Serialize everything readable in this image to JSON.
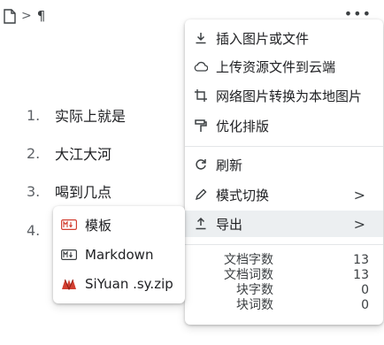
{
  "breadcrumb": {
    "doc_icon": "file-icon",
    "separator": ">",
    "block": "¶"
  },
  "toolbar": {
    "more_label": "•••"
  },
  "list": {
    "items": [
      {
        "num": "1.",
        "text": "实际上就是"
      },
      {
        "num": "2.",
        "text": "大江大河"
      },
      {
        "num": "3.",
        "text": "喝到几点"
      },
      {
        "num": "4.",
        "text": ""
      }
    ]
  },
  "menu": {
    "items": [
      {
        "icon": "download-icon",
        "label": "插入图片或文件"
      },
      {
        "icon": "cloud-icon",
        "label": "上传资源文件到云端"
      },
      {
        "icon": "crop-icon",
        "label": "网络图片转换为本地图片"
      },
      {
        "icon": "format-painter-icon",
        "label": "优化排版"
      },
      {
        "icon": "refresh-icon",
        "label": "刷新"
      },
      {
        "icon": "edit-icon",
        "label": "模式切换",
        "arrow": ">"
      },
      {
        "icon": "upload-icon",
        "label": "导出",
        "arrow": ">"
      }
    ],
    "stats": [
      {
        "label": "文档字数",
        "value": "13"
      },
      {
        "label": "文档词数",
        "value": "13"
      },
      {
        "label": "块字数",
        "value": "0"
      },
      {
        "label": "块词数",
        "value": "0"
      }
    ]
  },
  "submenu": {
    "items": [
      {
        "icon": "markdown-icon",
        "label": "模板"
      },
      {
        "icon": "markdown-icon",
        "label": "Markdown"
      },
      {
        "icon": "siyuan-icon",
        "label": "SiYuan .sy.zip"
      }
    ]
  },
  "colors": {
    "accent_red": "#d23f31",
    "active_bg": "#eceff1"
  }
}
